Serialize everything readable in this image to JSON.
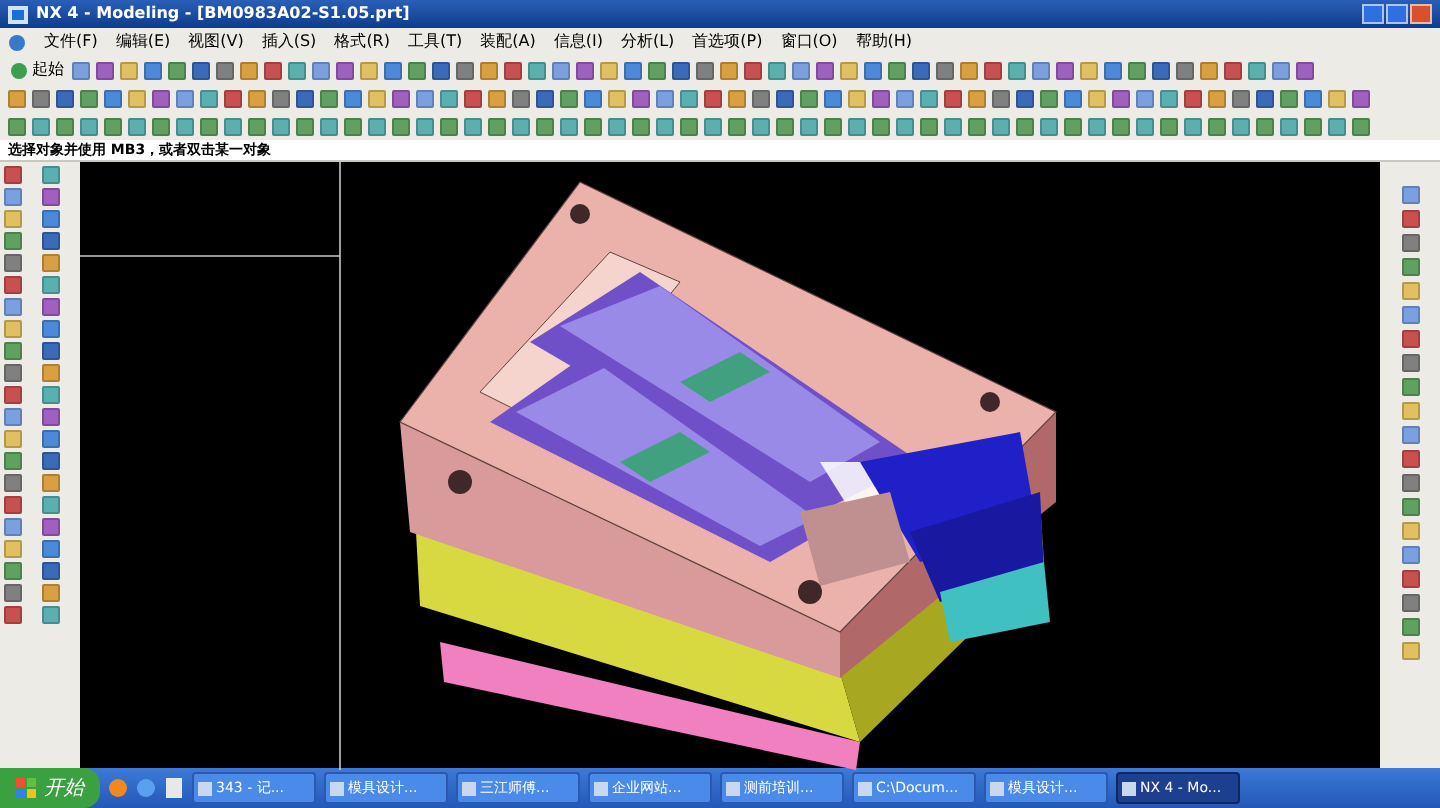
{
  "window": {
    "title": "NX 4 - Modeling - [BM0983A02-S1.05.prt]"
  },
  "menu": {
    "items": [
      "文件(F)",
      "编辑(E)",
      "视图(V)",
      "插入(S)",
      "格式(R)",
      "工具(T)",
      "装配(A)",
      "信息(I)",
      "分析(L)",
      "首选项(P)",
      "窗口(O)",
      "帮助(H)"
    ]
  },
  "toolbar": {
    "start_button": "起始"
  },
  "prompt": "选择对象并使用 MB3，或者双击某一对象",
  "taskbar": {
    "start": "开始",
    "items": [
      {
        "label": "343 - 记...",
        "selected": false
      },
      {
        "label": "模具设计...",
        "selected": false
      },
      {
        "label": "三江师傅...",
        "selected": false
      },
      {
        "label": "企业网站...",
        "selected": false
      },
      {
        "label": "测前培训...",
        "selected": false
      },
      {
        "label": "C:\\Docum...",
        "selected": false
      },
      {
        "label": "模具设计...",
        "selected": false
      },
      {
        "label": "NX 4 - Mo...",
        "selected": true
      }
    ]
  }
}
